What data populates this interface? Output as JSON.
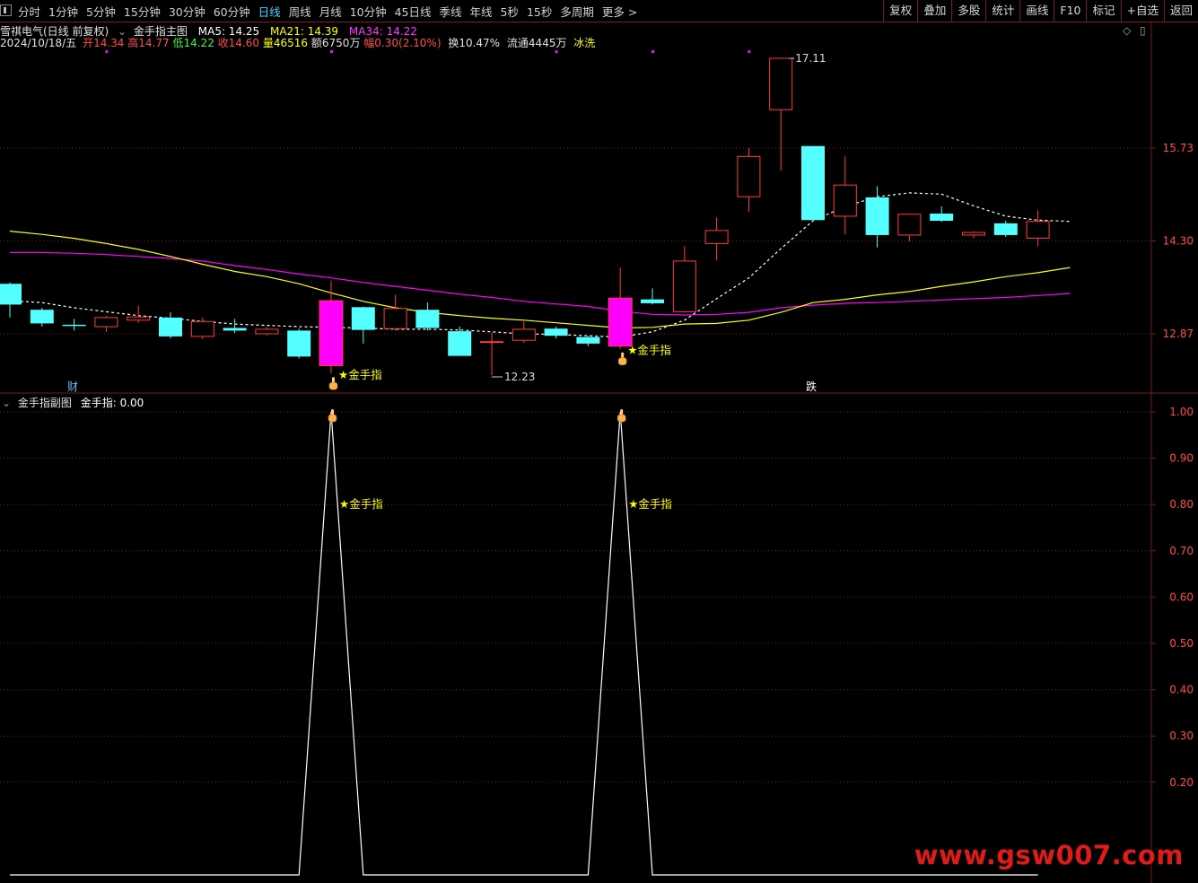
{
  "toolbar": {
    "tabs": [
      "分时",
      "1分钟",
      "5分钟",
      "15分钟",
      "30分钟",
      "60分钟",
      "日线",
      "周线",
      "月线",
      "10分钟",
      "45日线",
      "季线",
      "年线",
      "5秒",
      "15秒",
      "多周期",
      "更多 >"
    ],
    "active_tab": "日线",
    "right_buttons": [
      "复权",
      "叠加",
      "多股",
      "统计",
      "画线",
      "F10",
      "标记",
      "+自选",
      "返回"
    ]
  },
  "header": {
    "stock": "雪祺电气(日线 前复权)",
    "indicator_name": "金手指主图",
    "ma5": "MA5: 14.25",
    "ma21": "MA21: 14.39",
    "ma34": "MA34: 14.22",
    "ctrl_icons": [
      "◇",
      "▯"
    ]
  },
  "quote": {
    "date": "2024/10/18/五",
    "open_label": "开",
    "open": "14.34",
    "high_label": "高",
    "high": "14.77",
    "low_label": "低",
    "low": "14.22",
    "close_label": "收",
    "close": "14.60",
    "vol_label": "量",
    "volume": "46516",
    "amt_label": "额",
    "amount": "6750万",
    "chg_label": "幅",
    "change": "0.30(2.10%)",
    "turnover": "换10.47%",
    "float": "流通4445万",
    "tag": "冰洗"
  },
  "sub_header": {
    "title": "金手指副图",
    "value": "金手指: 0.00"
  },
  "colors": {
    "up": "#ff3c3c",
    "down": "#54ffff",
    "signal": "#ff00ff",
    "ma5": "#ffffff",
    "ma21": "#ffff00",
    "ma34": "#ff00ff",
    "grid": "#7a1a1a",
    "axis_text": "#ff4b4b",
    "marker": "#ffff00"
  },
  "chart_data": [
    {
      "type": "candlestick",
      "title": "金手指主图",
      "y_ticks": [
        12.87,
        14.3,
        15.73
      ],
      "ylim": [
        11.9,
        17.3
      ],
      "candles": [
        {
          "o": 13.64,
          "c": 13.32,
          "h": 13.66,
          "l": 13.12
        },
        {
          "o": 13.24,
          "c": 13.03,
          "h": 13.27,
          "l": 12.98
        },
        {
          "o": 13.01,
          "c": 12.99,
          "h": 13.1,
          "l": 12.92
        },
        {
          "o": 12.98,
          "c": 13.12,
          "h": 13.15,
          "l": 12.9
        },
        {
          "o": 13.08,
          "c": 13.13,
          "h": 13.3,
          "l": 13.04
        },
        {
          "o": 13.12,
          "c": 12.83,
          "h": 13.2,
          "l": 12.8
        },
        {
          "o": 12.83,
          "c": 13.06,
          "h": 13.12,
          "l": 12.79
        },
        {
          "o": 12.96,
          "c": 12.92,
          "h": 13.1,
          "l": 12.88
        },
        {
          "o": 12.87,
          "c": 12.94,
          "h": 12.97,
          "l": 12.85
        },
        {
          "o": 12.92,
          "c": 12.52,
          "h": 12.95,
          "l": 12.49
        },
        {
          "o": 13.38,
          "c": 12.38,
          "h": 13.69,
          "l": 12.26,
          "signal": true
        },
        {
          "o": 13.28,
          "c": 12.93,
          "h": 13.29,
          "l": 12.72
        },
        {
          "o": 12.95,
          "c": 13.26,
          "h": 13.47,
          "l": 12.92
        },
        {
          "o": 13.24,
          "c": 12.96,
          "h": 13.35,
          "l": 12.92
        },
        {
          "o": 12.91,
          "c": 12.53,
          "h": 12.98,
          "l": 12.53
        },
        {
          "o": 12.75,
          "c": 12.75,
          "h": 12.89,
          "l": 12.23
        },
        {
          "o": 12.77,
          "c": 12.94,
          "h": 13.06,
          "l": 12.73
        },
        {
          "o": 12.95,
          "c": 12.84,
          "h": 12.98,
          "l": 12.8
        },
        {
          "o": 12.82,
          "c": 12.72,
          "h": 12.84,
          "l": 12.68
        },
        {
          "o": 13.42,
          "c": 12.68,
          "h": 13.89,
          "l": 12.64,
          "signal": true
        },
        {
          "o": 13.4,
          "c": 13.34,
          "h": 13.57,
          "l": 13.32
        },
        {
          "o": 13.21,
          "c": 13.99,
          "h": 14.22,
          "l": 13.21
        },
        {
          "o": 14.26,
          "c": 14.46,
          "h": 14.66,
          "l": 14.0
        },
        {
          "o": 14.98,
          "c": 15.6,
          "h": 15.73,
          "l": 14.75
        },
        {
          "o": 16.32,
          "c": 17.11,
          "h": 17.11,
          "l": 15.38
        },
        {
          "o": 15.76,
          "c": 14.62,
          "h": 15.76,
          "l": 14.62
        },
        {
          "o": 14.68,
          "c": 15.16,
          "h": 15.6,
          "l": 14.4
        },
        {
          "o": 14.97,
          "c": 14.39,
          "h": 15.14,
          "l": 14.2
        },
        {
          "o": 14.39,
          "c": 14.71,
          "h": 14.72,
          "l": 14.29
        },
        {
          "o": 14.72,
          "c": 14.61,
          "h": 14.83,
          "l": 14.59
        },
        {
          "o": 14.39,
          "c": 14.43,
          "h": 14.45,
          "l": 14.34
        },
        {
          "o": 14.57,
          "c": 14.39,
          "h": 14.61,
          "l": 14.36
        },
        {
          "o": 14.34,
          "c": 14.6,
          "h": 14.77,
          "l": 14.22
        }
      ],
      "ma5": [
        13.38,
        13.35,
        13.27,
        13.21,
        13.15,
        13.11,
        13.06,
        13.02,
        13.0,
        12.98,
        12.97,
        12.96,
        12.94,
        12.94,
        12.93,
        12.9,
        12.87,
        12.86,
        12.84,
        12.82,
        12.9,
        13.08,
        13.41,
        13.73,
        14.18,
        14.61,
        14.83,
        14.98,
        15.04,
        15.02,
        14.84,
        14.68,
        14.62,
        14.6
      ],
      "ma21": [
        14.45,
        14.4,
        14.34,
        14.26,
        14.17,
        14.06,
        13.94,
        13.83,
        13.75,
        13.64,
        13.5,
        13.37,
        13.27,
        13.2,
        13.15,
        13.11,
        13.08,
        13.04,
        13.0,
        12.96,
        12.97,
        13.02,
        13.03,
        13.08,
        13.2,
        13.35,
        13.4,
        13.47,
        13.52,
        13.6,
        13.67,
        13.75,
        13.81,
        13.89
      ],
      "ma34": [
        14.12,
        14.12,
        14.11,
        14.09,
        14.06,
        14.03,
        13.99,
        13.92,
        13.86,
        13.79,
        13.73,
        13.66,
        13.6,
        13.54,
        13.48,
        13.43,
        13.37,
        13.33,
        13.29,
        13.22,
        13.17,
        13.16,
        13.17,
        13.2,
        13.27,
        13.31,
        13.34,
        13.35,
        13.37,
        13.39,
        13.41,
        13.43,
        13.46,
        13.49
      ],
      "annotations": {
        "high_label": "17.11",
        "low_label": "12.23",
        "signal_label": "★金手指",
        "bottom_tags": [
          "财",
          "跌"
        ]
      }
    },
    {
      "type": "line",
      "title": "金手指副图",
      "series": [
        {
          "name": "金手指",
          "values": [
            0,
            0,
            0,
            0,
            0,
            0,
            0,
            0,
            0,
            0,
            1,
            0,
            0,
            0,
            0,
            0,
            0,
            0,
            0,
            1,
            0,
            0,
            0,
            0,
            0,
            0,
            0,
            0,
            0,
            0,
            0,
            0,
            0
          ]
        }
      ],
      "y_ticks": [
        0.2,
        0.3,
        0.4,
        0.5,
        0.6,
        0.7,
        0.8,
        0.9,
        1.0
      ],
      "ylim": [
        0,
        1.0
      ],
      "annotations": {
        "signal_label": "★金手指"
      }
    }
  ],
  "watermark": "www.gsw007.com"
}
